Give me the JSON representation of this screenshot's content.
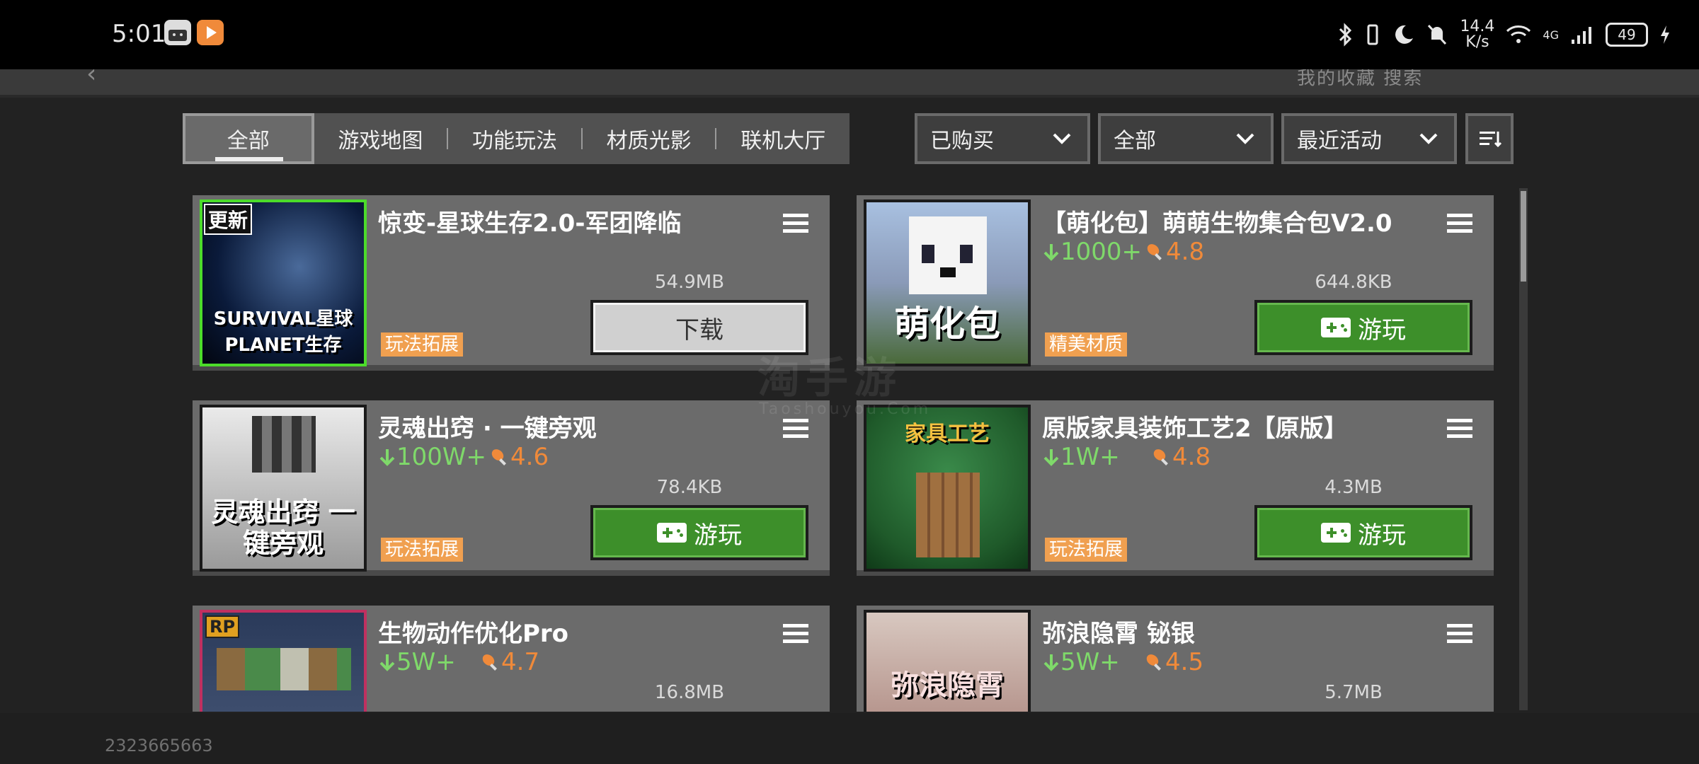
{
  "status_bar": {
    "time": "5:01",
    "net_speed_value": "14.4",
    "net_speed_unit": "K/s",
    "network_type": "4G",
    "battery": "49"
  },
  "top_bar": {
    "partial_links": "我的收藏   搜索"
  },
  "filter_tabs": [
    {
      "label": "全部",
      "active": true
    },
    {
      "label": "游戏地图",
      "active": false
    },
    {
      "label": "功能玩法",
      "active": false
    },
    {
      "label": "材质光影",
      "active": false
    },
    {
      "label": "联机大厅",
      "active": false
    }
  ],
  "dropdowns": [
    {
      "value": "已购买"
    },
    {
      "value": "全部"
    },
    {
      "value": "最近活动"
    }
  ],
  "cards": [
    {
      "title": "惊变-星球生存2.0-军团降临",
      "downloads": "",
      "rating": "",
      "size": "54.9MB",
      "tag": "玩法拓展",
      "button": "下载",
      "button_type": "download",
      "thumb_badge": "更新",
      "thumb_text": "SURVIVAL星球 PLANET生存",
      "thumb_color": "#0a1a3a"
    },
    {
      "title": "【萌化包】萌萌生物集合包V2.0",
      "downloads": "1000+",
      "rating": "4.8",
      "size": "644.8KB",
      "tag": "精美材质",
      "button": "游玩",
      "button_type": "play",
      "thumb_badge": "",
      "thumb_text": "萌化包",
      "thumb_color": "#8fa8c8"
    },
    {
      "title": "灵魂出窍 · 一键旁观",
      "downloads": "100W+",
      "rating": "4.6",
      "size": "78.4KB",
      "tag": "玩法拓展",
      "button": "游玩",
      "button_type": "play",
      "thumb_badge": "",
      "thumb_text": "灵魂出窍 一键旁观",
      "thumb_color": "#cfcfcf"
    },
    {
      "title": "原版家具装饰工艺2【原版】",
      "downloads": "1W+",
      "rating": "4.8",
      "size": "4.3MB",
      "tag": "玩法拓展",
      "button": "游玩",
      "button_type": "play",
      "thumb_badge": "",
      "thumb_text": "家具工艺",
      "thumb_color": "#1f5a2a"
    },
    {
      "title": "生物动作优化Pro",
      "downloads": "5W+",
      "rating": "4.7",
      "size": "16.8MB",
      "tag": "",
      "button": "",
      "button_type": "",
      "thumb_badge": "RP",
      "thumb_text": "",
      "thumb_color": "#2a3a5a"
    },
    {
      "title": "弥浪隐霄 铋银",
      "downloads": "5W+",
      "rating": "4.5",
      "size": "5.7MB",
      "tag": "",
      "button": "",
      "button_type": "",
      "thumb_badge": "",
      "thumb_text": "弥浪隐霄",
      "thumb_color": "#c8a8a0"
    }
  ],
  "footer": {
    "user_id": "2323665663"
  },
  "watermark": {
    "main": "淘手游",
    "sub": "Taoshouyou.Com"
  },
  "colors": {
    "play_green": "#3d8f2a",
    "downloads_green": "#7fd96a",
    "rating_orange": "#f08a3a",
    "tag_orange": "#f0a050"
  }
}
